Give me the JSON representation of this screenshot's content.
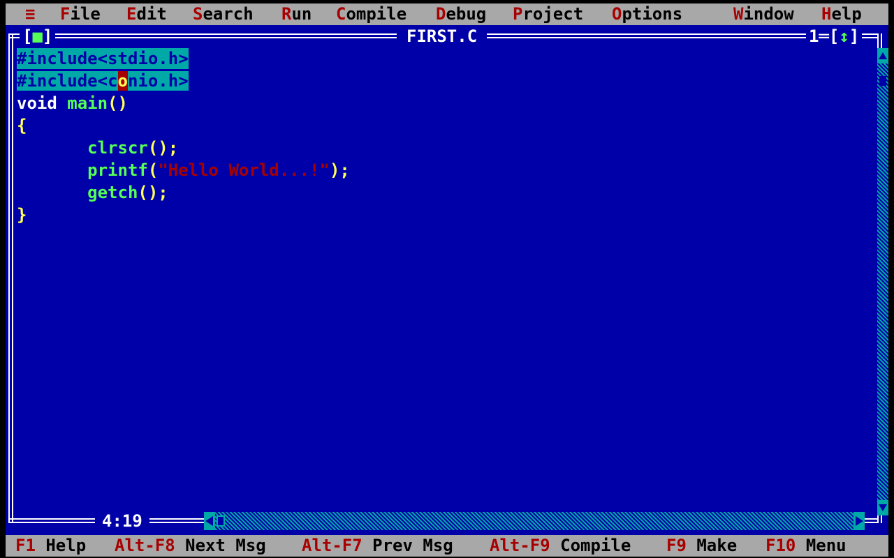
{
  "menu": {
    "system": "≡",
    "items": [
      {
        "hot": "F",
        "rest": "ile"
      },
      {
        "hot": "E",
        "rest": "dit"
      },
      {
        "hot": "S",
        "rest": "earch"
      },
      {
        "hot": "R",
        "rest": "un"
      },
      {
        "hot": "C",
        "rest": "ompile"
      },
      {
        "hot": "D",
        "rest": "ebug"
      },
      {
        "hot": "P",
        "rest": "roject"
      },
      {
        "hot": "O",
        "rest": "ptions"
      },
      {
        "hot": "W",
        "rest": "indow"
      },
      {
        "hot": "H",
        "rest": "elp"
      }
    ]
  },
  "window": {
    "close_open": "[",
    "close_mark": "■",
    "close_close": "]",
    "title": "FIRST.C",
    "number": "1",
    "zoom_open": "[",
    "zoom_mark": "↕",
    "zoom_close": "]"
  },
  "code": {
    "line1": "#include<stdio.h>",
    "line2_a": "#include<c",
    "line2_cursor": "o",
    "line2_b": "nio.h>",
    "line3_kw": "void",
    "line3_fn": "main",
    "line3_pun": "()",
    "line4": "{",
    "line5_indent": "       ",
    "line5_fn": "clrscr",
    "line5_pun": "();",
    "line6_indent": "       ",
    "line6_fn": "printf",
    "line6_p1": "(",
    "line6_str": "\"Hello World...!\"",
    "line6_p2": ");",
    "line7_indent": "       ",
    "line7_fn": "getch",
    "line7_pun": "();",
    "line8": "}"
  },
  "cursor_position": "4:19",
  "status": [
    {
      "key": "F1",
      "label": "Help"
    },
    {
      "key": "Alt-F8",
      "label": "Next Msg"
    },
    {
      "key": "Alt-F7",
      "label": "Prev Msg"
    },
    {
      "key": "Alt-F9",
      "label": "Compile"
    },
    {
      "key": "F9",
      "label": "Make"
    },
    {
      "key": "F10",
      "label": "Menu"
    }
  ],
  "colors": {
    "editor_bg": "#0000a8",
    "menu_bg": "#a8a8a8",
    "hotkey": "#a80000",
    "selection": "#00a8a8",
    "function": "#55ff55",
    "punctuation": "#ffff55",
    "string": "#a80000"
  }
}
